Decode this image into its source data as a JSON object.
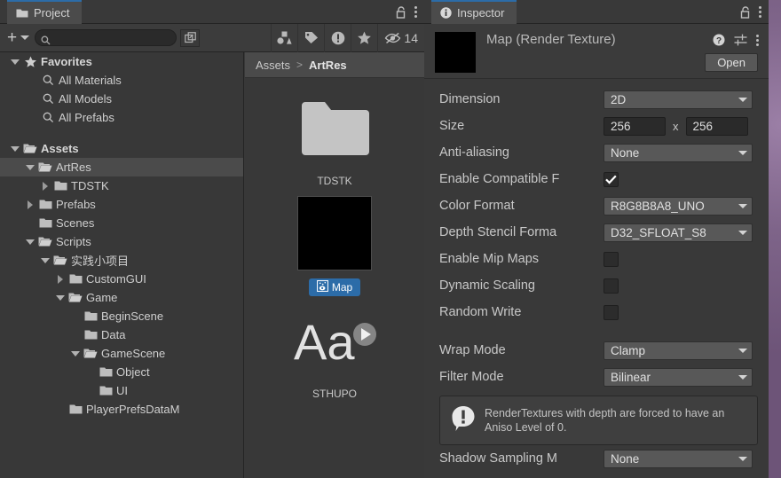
{
  "window": {
    "project_tab": {
      "label": "Project",
      "icon": "folder-icon"
    },
    "inspector_tab": {
      "label": "Inspector",
      "icon": "info-icon"
    },
    "lock_icon": "lock-open-icon",
    "menu_icon": "kebab-menu-icon"
  },
  "project_toolbar": {
    "add_label": "+",
    "add_icon": "plus-icon",
    "add_dropdown_icon": "chevron-down-icon",
    "search_placeholder": "",
    "search_value": "",
    "search_icon": "search-icon",
    "expand_icon": "expand-search-icon",
    "filters": [
      {
        "name": "filter-by-type-icon",
        "icon": "shapes-icon"
      },
      {
        "name": "filter-by-label-icon",
        "icon": "tag-icon"
      },
      {
        "name": "filter-by-error-icon",
        "icon": "warning-icon"
      },
      {
        "name": "filter-by-favorite-icon",
        "icon": "star-icon"
      }
    ],
    "hidden_count": "14",
    "hidden_icon": "eye-slash-icon"
  },
  "tree": {
    "favorites": {
      "label": "Favorites",
      "expanded": true,
      "icon": "star-icon",
      "items": [
        {
          "label": "All Materials",
          "icon": "search-icon"
        },
        {
          "label": "All Models",
          "icon": "search-icon"
        },
        {
          "label": "All Prefabs",
          "icon": "search-icon"
        }
      ]
    },
    "assets": [
      {
        "label": "Assets",
        "depth": 0,
        "twisty": "down",
        "icon": "folder-open-icon",
        "bold": true,
        "selected": false
      },
      {
        "label": "ArtRes",
        "depth": 1,
        "twisty": "down",
        "icon": "folder-open-icon",
        "bold": false,
        "selected": true
      },
      {
        "label": "TDSTK",
        "depth": 2,
        "twisty": "right",
        "icon": "folder-icon",
        "bold": false,
        "selected": false
      },
      {
        "label": "Prefabs",
        "depth": 1,
        "twisty": "right",
        "icon": "folder-icon",
        "bold": false,
        "selected": false
      },
      {
        "label": "Scenes",
        "depth": 1,
        "twisty": "none",
        "icon": "folder-icon",
        "bold": false,
        "selected": false
      },
      {
        "label": "Scripts",
        "depth": 1,
        "twisty": "down",
        "icon": "folder-open-icon",
        "bold": false,
        "selected": false
      },
      {
        "label": "实践小项目",
        "depth": 2,
        "twisty": "down",
        "icon": "folder-open-icon",
        "bold": false,
        "selected": false
      },
      {
        "label": "CustomGUI",
        "depth": 3,
        "twisty": "right",
        "icon": "folder-icon",
        "bold": false,
        "selected": false
      },
      {
        "label": "Game",
        "depth": 3,
        "twisty": "down",
        "icon": "folder-open-icon",
        "bold": false,
        "selected": false
      },
      {
        "label": "BeginScene",
        "depth": 4,
        "twisty": "none",
        "icon": "folder-icon",
        "bold": false,
        "selected": false
      },
      {
        "label": "Data",
        "depth": 4,
        "twisty": "none",
        "icon": "folder-icon",
        "bold": false,
        "selected": false
      },
      {
        "label": "GameScene",
        "depth": 4,
        "twisty": "down",
        "icon": "folder-open-icon",
        "bold": false,
        "selected": false
      },
      {
        "label": "Object",
        "depth": 5,
        "twisty": "none",
        "icon": "folder-icon",
        "bold": false,
        "selected": false
      },
      {
        "label": "UI",
        "depth": 5,
        "twisty": "none",
        "icon": "folder-icon",
        "bold": false,
        "selected": false
      },
      {
        "label": "PlayerPrefsDataM",
        "depth": 3,
        "twisty": "none",
        "icon": "folder-icon",
        "bold": false,
        "selected": false
      }
    ]
  },
  "browser": {
    "breadcrumb_root": "Assets",
    "breadcrumb_sep": ">",
    "breadcrumb_current": "ArtRes",
    "items": [
      {
        "name": "TDSTK",
        "type": "folder",
        "selected": false
      },
      {
        "name": "Map",
        "type": "render-texture",
        "selected": true
      },
      {
        "name": "STHUPO",
        "type": "font",
        "selected": false
      }
    ]
  },
  "inspector": {
    "asset_title": "Map (Render Texture)",
    "help_icon": "help-icon",
    "preset_icon": "preset-settings-icon",
    "menu_icon": "kebab-menu-icon",
    "open_button": "Open",
    "properties": [
      {
        "label": "Dimension",
        "control": "dropdown",
        "value": "2D"
      },
      {
        "label": "Size",
        "control": "size",
        "value": "256",
        "value2": "256",
        "separator": "x"
      },
      {
        "label": "Anti-aliasing",
        "control": "dropdown",
        "value": "None"
      },
      {
        "label": "Enable Compatible F",
        "control": "checkbox",
        "checked": true
      },
      {
        "label": "Color Format",
        "control": "dropdown",
        "value": "R8G8B8A8_UNO"
      },
      {
        "label": "Depth Stencil Forma",
        "control": "dropdown",
        "value": "D32_SFLOAT_S8"
      },
      {
        "label": "Enable Mip Maps",
        "control": "checkbox",
        "checked": false
      },
      {
        "label": "Dynamic Scaling",
        "control": "checkbox",
        "checked": false
      },
      {
        "label": "Random Write",
        "control": "checkbox",
        "checked": false
      }
    ],
    "properties2": [
      {
        "label": "Wrap Mode",
        "control": "dropdown",
        "value": "Clamp"
      },
      {
        "label": "Filter Mode",
        "control": "dropdown",
        "value": "Bilinear"
      }
    ],
    "helpbox": {
      "icon": "warning-icon",
      "text": "RenderTextures with depth are forced to have an Aniso Level of 0."
    },
    "properties3": [
      {
        "label": "Shadow Sampling M",
        "control": "dropdown",
        "value": "None"
      }
    ]
  },
  "colors": {
    "accent_blue": "#2c6ca8",
    "panel_bg": "#383838",
    "toolbar_bg": "#3c3c3c",
    "selection": "#4b4b4b"
  }
}
